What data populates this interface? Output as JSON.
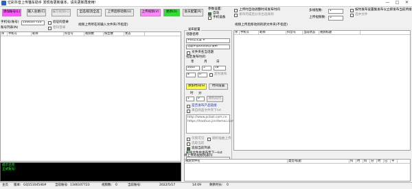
{
  "window": {
    "title": "亿彩抖音上传猫车助手  发现有更新版本，请先更新再使用!",
    "minimize": "—",
    "maximize": "□",
    "close": "✕"
  },
  "toolbar": {
    "add_account": "添加账号(L)",
    "import_config": "输入总委(C)",
    "edit_video": "编写视频(C)",
    "select_all": "全选/取消全选",
    "upload_mobile": "上传后移动到(U)",
    "upload_video": "上传视频(V)",
    "update": "更新(D)",
    "member_config": "会员配置(R)",
    "colors": {
      "add": "#ff55ff",
      "upload": "#ff88ff",
      "update": "#33dd33"
    }
  },
  "options": {
    "params_label": "参数设置:",
    "opt_auto": "自动",
    "opt_manual": "手机设备",
    "schedule_label": "上传时自动调整时间发布时间",
    "publish_share": "发布完成后分享出选择到",
    "multi_thread_label": "多线程数:",
    "thread_count": "1",
    "upload_count_label": "上传视频数:",
    "upload_count": "5",
    "sync_label": "按时发布设置集发布以立即发布当前所接",
    "only_share": "选中文件"
  },
  "left": {
    "phone_label": "手机号(账号)",
    "phone_value": "1346107723",
    "verify_login": "验证码登录",
    "pwd_login": "密码登录",
    "account_list_label": "账号列表(N)",
    "video_path_label": "视频上传所在的输入文件夹(不指定)",
    "columns": [
      "序",
      "手机号",
      "昵称",
      "抖音号",
      "视频数",
      "粉丝数",
      "状态"
    ],
    "log_line1": "提示已完",
    "log_line2": "正式账号:"
  },
  "middle": {
    "group_title": "发布配置",
    "desc_label": "话题名称",
    "desc_value": "#抖音文案 #",
    "topic_value": "话题#@xxxx同步发布",
    "loc_check": "文件夹名当话题",
    "time_label": "指定发布时间:",
    "year_label": "年",
    "month_label": "月",
    "day_label": "日",
    "year": "2022",
    "month": "5",
    "day": "18",
    "hour": "8",
    "minute": "0",
    "timed_publish": "定时发布",
    "add_time_btn": "添加时间(S)",
    "time_config_btn": "时间设置",
    "interval_label": "时",
    "interval_min": "分",
    "interval_h": "1",
    "interval_m": "0",
    "add_delay": "随机延时",
    "post_link_check": "是否发布产品链接",
    "link_text": "来自商品文件夹下txt",
    "url1": "http://www.pcbat.com.cn",
    "url2": "https://haohuo.jinritemai.com",
    "opt_visible": "仅限可见",
    "opt_random": "随机插曲上传",
    "opt_current": "选取当前",
    "list_folder_check": "追加当前列表",
    "publish_after_label": "删除文件并发布至下一list"
  },
  "right": {
    "folder_label": "视频上传后移动到的新文件夹(不指定)",
    "top_columns": [
      "序",
      "手机号",
      "昵称",
      "抖音号",
      "当前状态",
      "视频标题"
    ],
    "bottom_label": "待上传的视频列表(I)",
    "bottom_columns": [
      "视频文件名",
      "类型/标题",
      "抖",
      "时",
      "抖",
      "分",
      "时",
      "已",
      "平"
    ]
  },
  "status": {
    "main": "主页",
    "version_label": "版本:",
    "version": "GQ15104546#",
    "phone_label": "当前账号:",
    "phone": "1346107723",
    "video_count_label": "视频数:",
    "video_count": "0",
    "active_label": "当前账号:",
    "active": "",
    "date": "2022/5/17",
    "time": "14:09",
    "remaining_label": "剩余时长:",
    "remaining": "0"
  }
}
